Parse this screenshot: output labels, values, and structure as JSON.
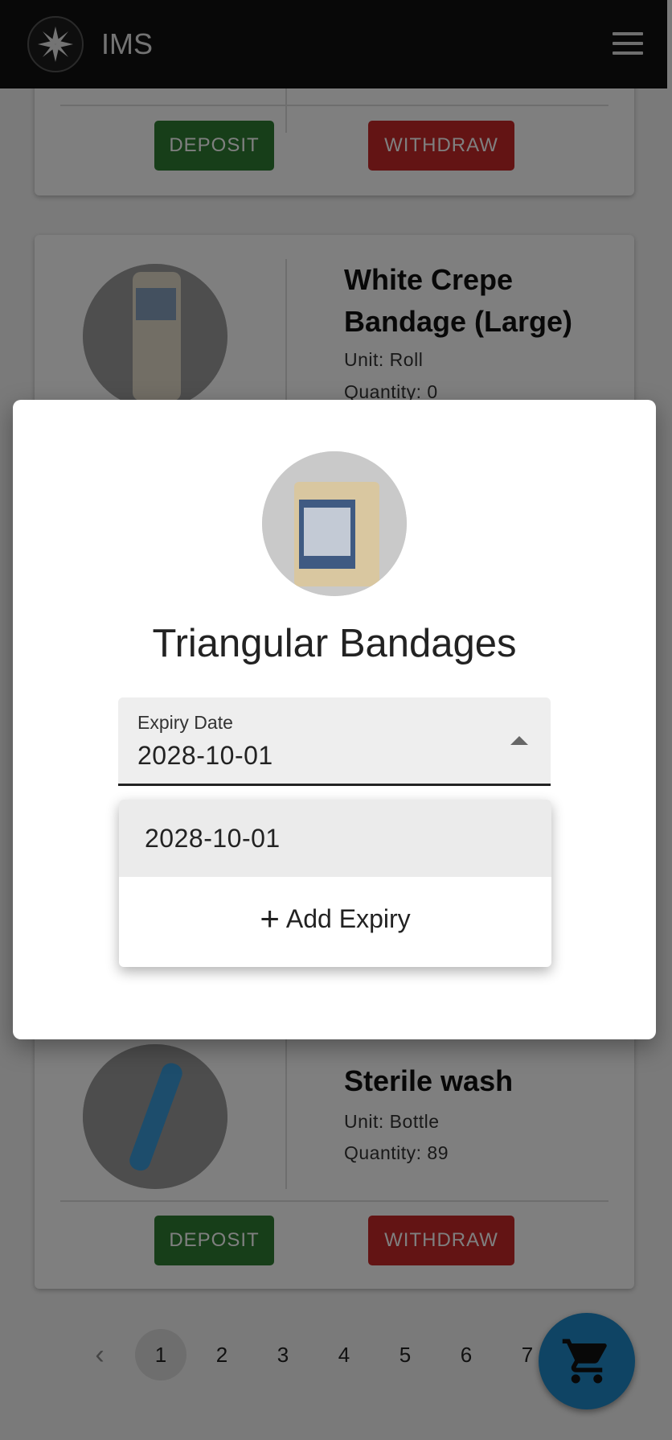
{
  "header": {
    "app_title": "IMS"
  },
  "cards": [
    {
      "deposit_label": "DEPOSIT",
      "withdraw_label": "WITHDRAW"
    },
    {
      "name_line1": "White Crepe",
      "name_line2": "Bandage (Large)",
      "unit": "Unit: Roll",
      "quantity": "Quantity: 0"
    },
    {
      "name": "Sterile wash",
      "unit": "Unit: Bottle",
      "quantity": "Quantity: 89",
      "deposit_label": "DEPOSIT",
      "withdraw_label": "WITHDRAW"
    }
  ],
  "pagination": {
    "prev": "‹",
    "pages": [
      "1",
      "2",
      "3",
      "4",
      "5",
      "6",
      "7"
    ],
    "active": "1"
  },
  "dialog": {
    "title": "Triangular Bandages",
    "select": {
      "label": "Expiry Date",
      "value": "2028-10-01"
    },
    "menu": {
      "option": "2028-10-01",
      "add_label": "Add Expiry",
      "add_icon": "+"
    }
  },
  "colors": {
    "deposit": "#2e7d32",
    "withdraw": "#c62828",
    "appbar": "#111111",
    "fab": "#1e88c8"
  },
  "icons": [
    "logo-cross-icon",
    "menu-icon",
    "cart-icon",
    "chevron-left-icon",
    "arrow-up-icon",
    "plus-icon"
  ]
}
